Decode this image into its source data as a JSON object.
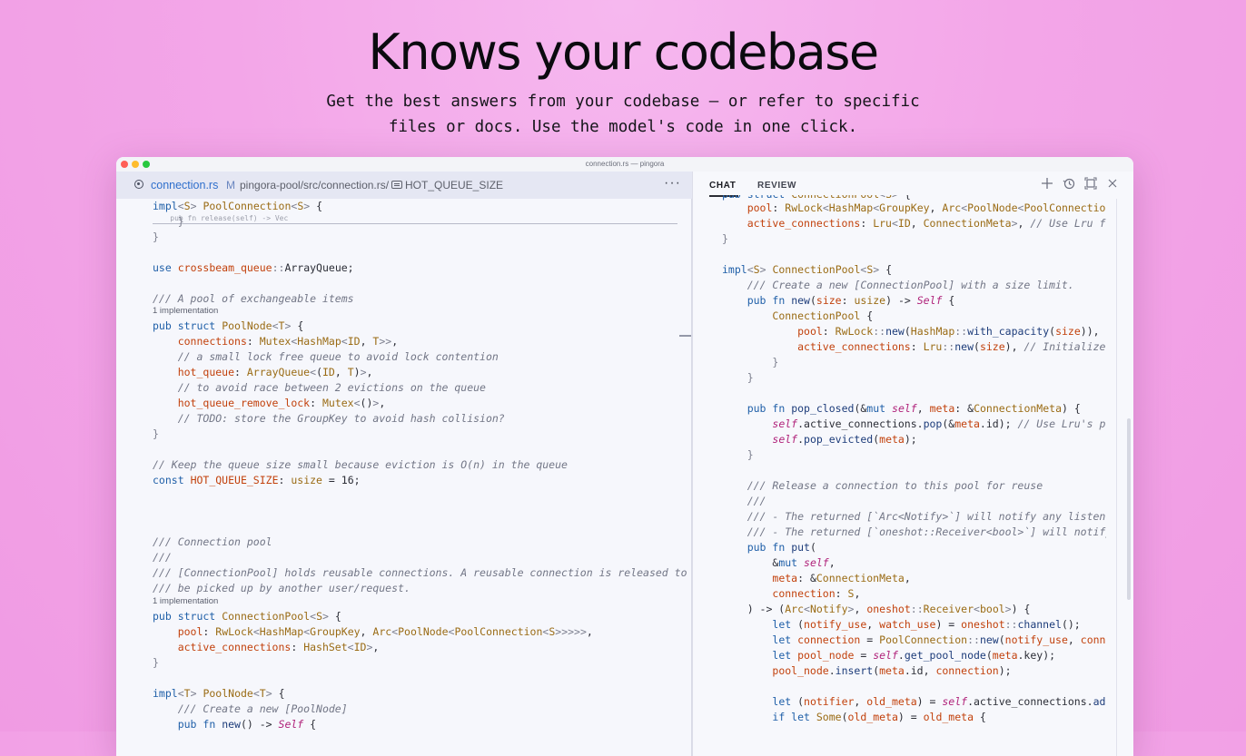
{
  "hero": {
    "title": "Knows your codebase",
    "subtitle_line1": "Get the best answers from your codebase — or refer to specific",
    "subtitle_line2": "files or docs. Use the model's code in one click."
  },
  "window": {
    "title": "connection.rs — pingora"
  },
  "editor": {
    "tab_filename": "connection.rs",
    "tab_modified": "M",
    "breadcrumb": "pingora-pool/src/connection.rs/",
    "breadcrumb_symbol": "HOT_QUEUE_SIZE",
    "more_label": "···"
  },
  "chat": {
    "tab_chat": "CHAT",
    "tab_review": "REVIEW",
    "icons": [
      "plus-icon",
      "history-icon",
      "maximize-icon",
      "close-icon"
    ]
  },
  "colors": {
    "keyword": "#1f5fa8",
    "type": "#9a6b14",
    "field": "#c2410c",
    "comment": "#727686",
    "self": "#b0227a",
    "tab_active": "#2f6fcc"
  }
}
